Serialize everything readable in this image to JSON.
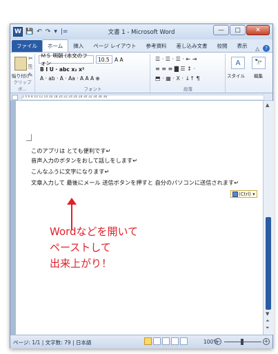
{
  "window": {
    "title": "文書 1 - Microsoft Word",
    "word_icon": "W",
    "qat": [
      "💾",
      "↶",
      "↷",
      "▾",
      "|="
    ],
    "controls": {
      "minimize": "—",
      "maximize": "□",
      "close": "✕"
    }
  },
  "tabs": {
    "file": "ファイル",
    "items": [
      "ホーム",
      "挿入",
      "ページ レイアウト",
      "参考資料",
      "差し込み文書",
      "校閲",
      "表示"
    ],
    "right_icon": "△",
    "help": "?"
  },
  "ribbon": {
    "clipboard": {
      "paste_label": "貼り付け",
      "group_label": "クリップボ..."
    },
    "font": {
      "font_name": "ＭＳ 明朝 (本文のフォン",
      "font_size": "10.5",
      "row1_extra": "A A",
      "row2": "B  I  U ·  abc  x₂  x²",
      "row3": "A · ab · A · Aa · A A  A ⊕",
      "group_label": "フォント"
    },
    "paragraph": {
      "row1": "☰ · ☰ · ☰ ·  ⇤ ⇥",
      "row2": "≡  ≡  ≡  ▇  ☰  ↕ ·",
      "row3": "⬒ · ▦ ·   X · ↓↑  ¶",
      "group_label": "段落"
    },
    "styles": {
      "icon": "A",
      "label": "スタイル"
    },
    "edit": {
      "icon": "🔭",
      "label": "編集"
    }
  },
  "ruler": {
    "ticks": "2   4   6   8   10   12   14   16   18   20   22   24   26   28   30   32   34   36   38"
  },
  "document": {
    "lines": [
      "このアプリは とても便利です↵",
      "音声入力のボタンをおして話しをします↵",
      "こんなふうに文字になります↵",
      "文章入力して 最後にメール 送信ボタンを押すと 自分のパソコンに送信されます↵"
    ],
    "paste_options": "(Ctrl) ▾",
    "annotation": [
      "Wordなどを開いて",
      "ペーストして",
      "出来上がり！"
    ]
  },
  "statusbar": {
    "page": "ページ: 1/1",
    "words": "文字数: 79",
    "language": "日本語",
    "zoom": "100%"
  },
  "colors": {
    "accent": "#2a5ba5",
    "annotation": "#e0202a"
  }
}
